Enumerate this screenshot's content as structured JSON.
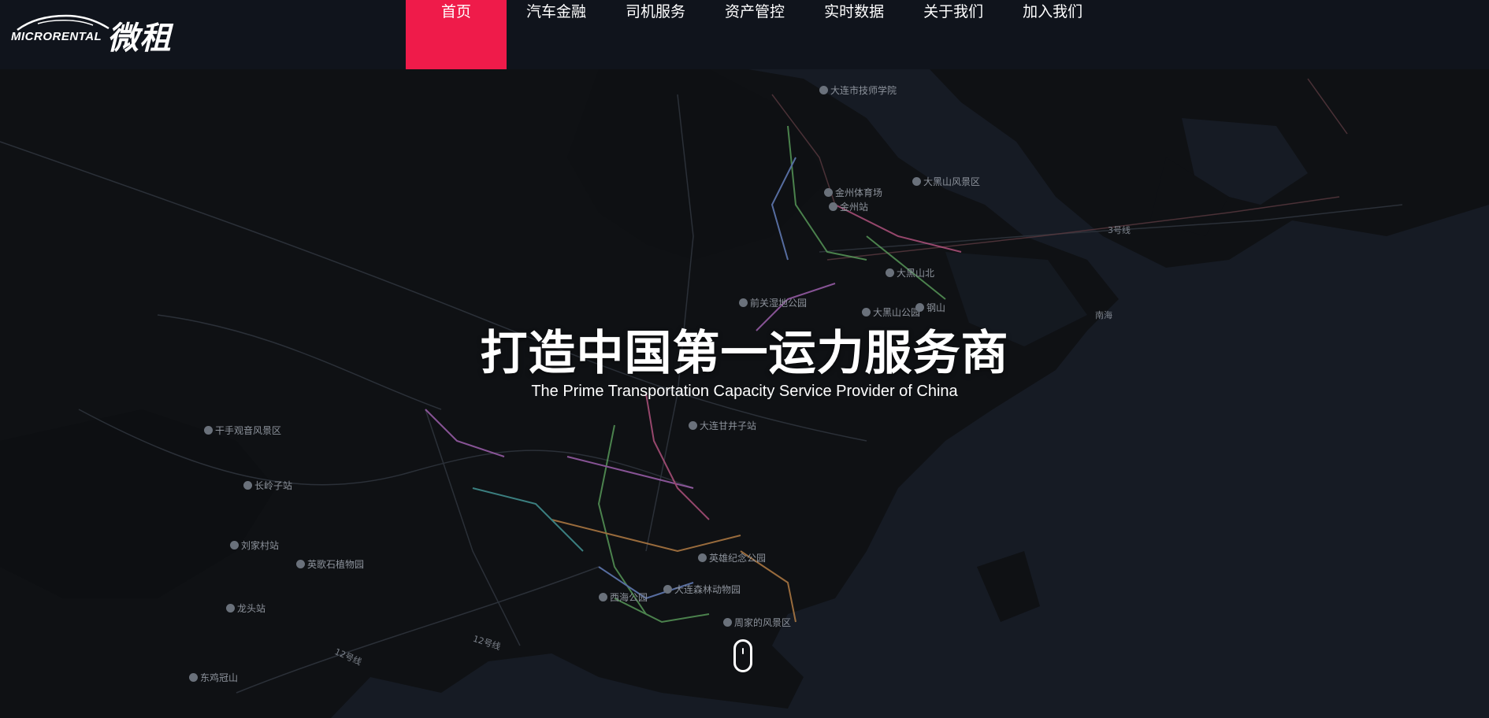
{
  "brand": {
    "logo_text": "MICRORENTAL",
    "logo_chinese": "微租"
  },
  "nav": {
    "items": [
      {
        "label": "首页",
        "active": true
      },
      {
        "label": "汽车金融",
        "active": false
      },
      {
        "label": "司机服务",
        "active": false
      },
      {
        "label": "资产管控",
        "active": false
      },
      {
        "label": "实时数据",
        "active": false
      },
      {
        "label": "关于我们",
        "active": false
      },
      {
        "label": "加入我们",
        "active": false
      }
    ]
  },
  "hero": {
    "title": "打造中国第一运力服务商",
    "subtitle": "The Prime Transportation Capacity Service Provider of China"
  },
  "map": {
    "pois": [
      "大连市技师学院",
      "大黑山风景区",
      "金州体育场",
      "金州站",
      "大黑山北",
      "前关湿地公园",
      "大黑山公园",
      "钢山",
      "大连甘井子站",
      "干手观音风景区",
      "长岭子站",
      "刘家村站",
      "英歌石植物园",
      "龙头站",
      "东鸡冠山",
      "英雄纪念公园",
      "大连森林动物园",
      "西海公园",
      "周家的风景区"
    ],
    "road_labels": [
      "3号线",
      "12号线",
      "12号线",
      "南海"
    ]
  },
  "colors": {
    "accent": "#ef1b4a",
    "navbar_bg": "#0f131b",
    "map_water": "#151a22",
    "map_land": "#101216"
  }
}
